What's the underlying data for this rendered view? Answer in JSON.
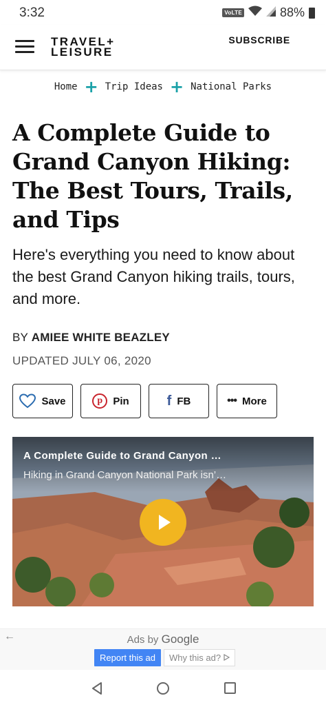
{
  "status_bar": {
    "time": "3:32",
    "network_badge": "VoLTE",
    "battery_percent": "88%",
    "icons": [
      "wifi-icon",
      "signal-icon",
      "battery-icon"
    ]
  },
  "header": {
    "logo_line1": "TRAVEL+",
    "logo_line2": "LEISURE",
    "subscribe_label": "SUBSCRIBE",
    "menu_icon": "hamburger-menu-icon"
  },
  "breadcrumb": {
    "items": [
      "Home",
      "Trip Ideas",
      "National Parks"
    ],
    "separator": "+",
    "separator_color": "#1aa1a8"
  },
  "article": {
    "title": "A Complete Guide to Grand Canyon Hiking: The Best Tours, Trails, and Tips",
    "dek": "Here's everything you need to know about the best Grand Canyon hiking trails, tours, and more.",
    "byline_prefix": "BY",
    "author": "AMIEE WHITE BEAZLEY",
    "updated": "UPDATED JULY 06, 2020"
  },
  "share": {
    "save_label": "Save",
    "pin_label": "Pin",
    "fb_label": "FB",
    "more_label": "More",
    "icons": [
      "heart-icon",
      "pinterest-icon",
      "facebook-icon",
      "more-dots-icon"
    ]
  },
  "video": {
    "title": "A Complete Guide to Grand Canyon …",
    "description": "Hiking in Grand Canyon National Park isn’…",
    "play_color": "#f1b520"
  },
  "ad": {
    "ads_by": "Ads by",
    "google": "Google",
    "report_label": "Report this ad",
    "why_label": "Why this ad?",
    "report_color": "#4285f4"
  },
  "nav": {
    "icons": [
      "back-triangle-icon",
      "home-circle-icon",
      "recents-square-icon"
    ]
  }
}
